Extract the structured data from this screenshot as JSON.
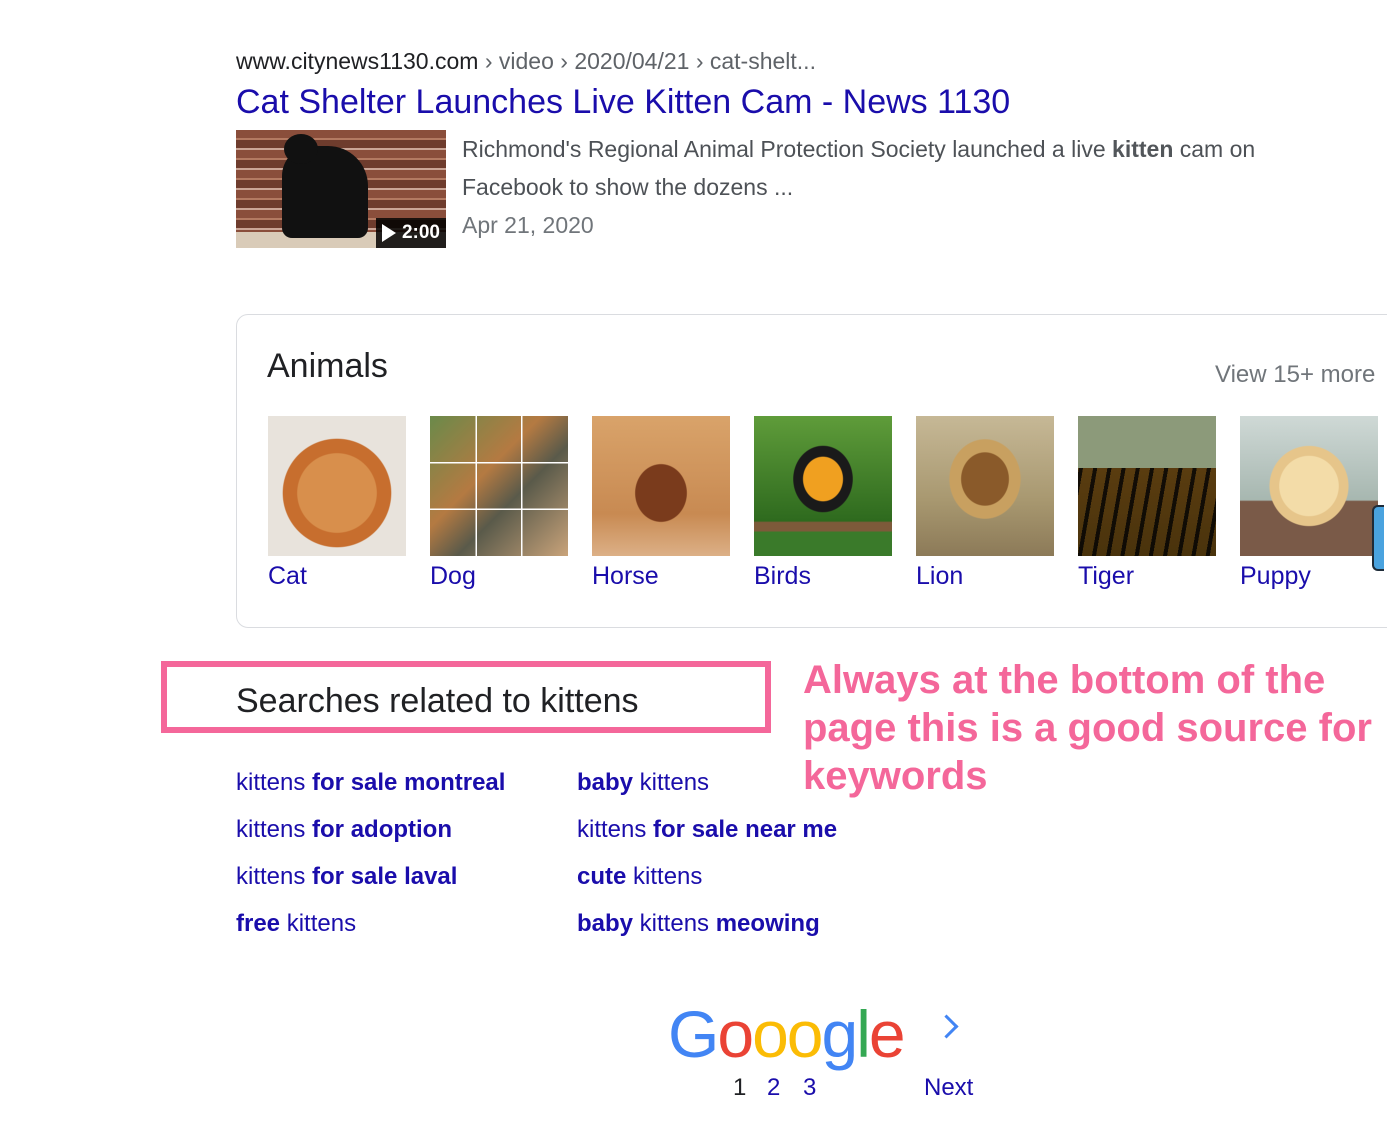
{
  "result": {
    "site": "www.citynews1130.com",
    "path": " › video › 2020/04/21 › cat-shelt...",
    "title": "Cat Shelter Launches Live Kitten Cam - News 1130",
    "snippet_before": "Richmond's Regional Animal Protection Society launched a live ",
    "snippet_bold": "kitten",
    "snippet_after": " cam on Facebook to show the dozens ...",
    "date": "Apr 21, 2020",
    "video_duration": "2:00"
  },
  "animals": {
    "title": "Animals",
    "view_more": "View 15+ more",
    "items": [
      {
        "label": "Cat"
      },
      {
        "label": "Dog"
      },
      {
        "label": "Horse"
      },
      {
        "label": "Birds"
      },
      {
        "label": "Lion"
      },
      {
        "label": "Tiger"
      },
      {
        "label": "Puppy"
      }
    ]
  },
  "related": {
    "heading": "Searches related to kittens",
    "left": [
      {
        "plain": "kittens ",
        "bold": "for sale montreal"
      },
      {
        "plain": "kittens ",
        "bold": "for adoption"
      },
      {
        "plain": "kittens ",
        "bold": "for sale laval"
      },
      {
        "bold_first": "free",
        "plain_after": " kittens"
      }
    ],
    "right": [
      {
        "bold_first": "baby",
        "plain_after": " kittens"
      },
      {
        "plain": "kittens ",
        "bold": "for sale near me"
      },
      {
        "bold_first": "cute",
        "plain_after": " kittens"
      },
      {
        "bold_first": "baby",
        "plain_mid": " kittens ",
        "bold_last": "meowing"
      }
    ]
  },
  "annotation": {
    "text": "Always at the bottom of the page this is a good source for keywords",
    "color": "#f4679a"
  },
  "pagination": {
    "logo_letters": [
      "G",
      "o",
      "o",
      "o",
      "g",
      "l",
      "e"
    ],
    "pages": [
      "1",
      "2",
      "3"
    ],
    "current_page": "1",
    "next_label": "Next"
  },
  "colors": {
    "link": "#1a0dab",
    "highlight": "#f4679a"
  }
}
